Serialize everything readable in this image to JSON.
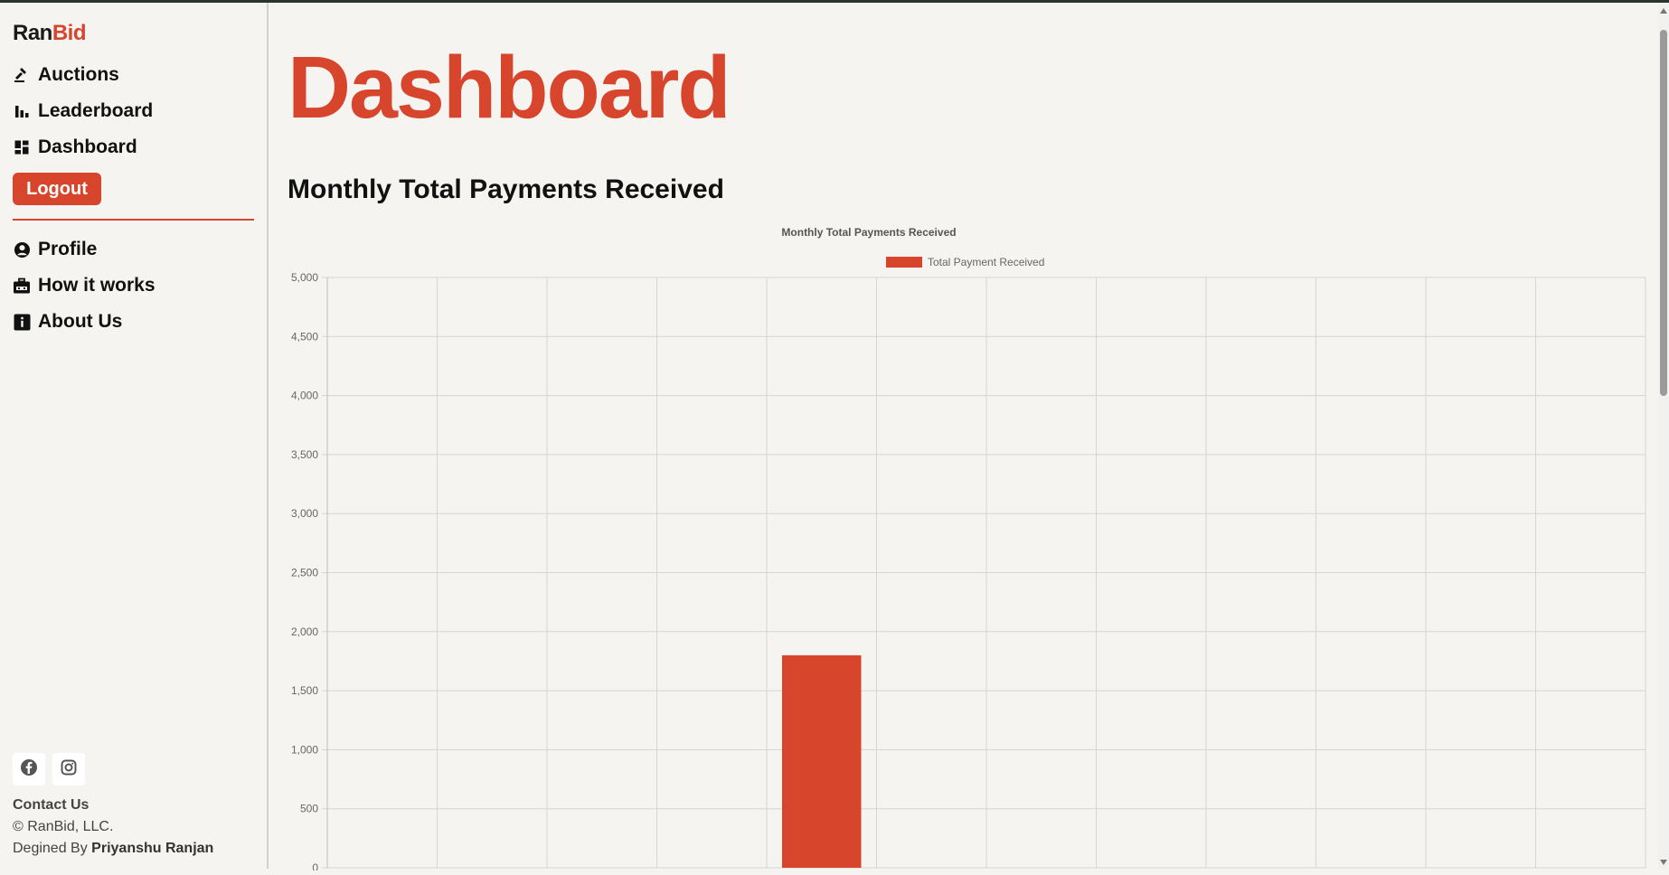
{
  "brand": {
    "part1": "Ran",
    "part2": "Bid"
  },
  "nav": {
    "primary": [
      {
        "label": "Auctions",
        "icon": "gavel-icon"
      },
      {
        "label": "Leaderboard",
        "icon": "bar-chart-icon"
      },
      {
        "label": "Dashboard",
        "icon": "dashboard-icon"
      }
    ],
    "logout_label": "Logout",
    "secondary": [
      {
        "label": "Profile",
        "icon": "user-circle-icon"
      },
      {
        "label": "How it works",
        "icon": "briefcase-icon"
      },
      {
        "label": "About Us",
        "icon": "info-icon"
      }
    ]
  },
  "footer": {
    "contact": "Contact Us",
    "copyright": "© RanBid, LLC.",
    "designed_by": "Degined By",
    "author": "Priyanshu Ranjan"
  },
  "main": {
    "title": "Dashboard",
    "section_title": "Monthly Total Payments Received"
  },
  "colors": {
    "accent": "#d6452c",
    "background": "#f5f4f0",
    "text": "#111111"
  },
  "chart_data": {
    "type": "bar",
    "title": "Monthly Total Payments Received",
    "legend": "top",
    "grid": true,
    "series": [
      {
        "name": "Total Payment Received",
        "color": "#d6452c",
        "values": [
          0,
          0,
          0,
          0,
          1800,
          0,
          0,
          0,
          0,
          0,
          0,
          0
        ]
      }
    ],
    "categories_count": 12,
    "ylim": [
      0,
      5000
    ],
    "yticks": [
      "0",
      "500",
      "1,000",
      "1,500",
      "2,000",
      "2,500",
      "3,000",
      "3,500",
      "4,000",
      "4,500",
      "5,000"
    ]
  }
}
